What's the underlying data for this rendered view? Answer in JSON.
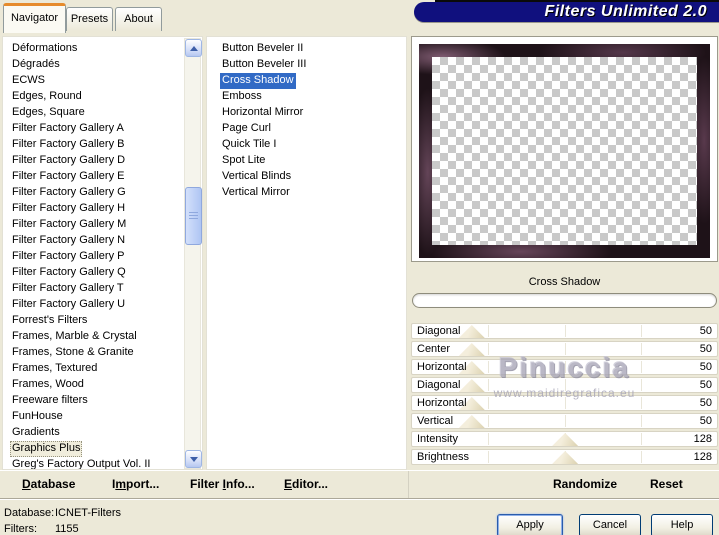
{
  "window": {
    "title": "Filters Unlimited 2.0"
  },
  "tabs": [
    {
      "label": "Navigator",
      "selected": true
    },
    {
      "label": "Presets",
      "selected": false
    },
    {
      "label": "About",
      "selected": false
    }
  ],
  "category_list": {
    "selected_index": 25,
    "items": [
      "Déformations",
      "Dégradés",
      "ECWS",
      "Edges, Round",
      "Edges, Square",
      "Filter Factory Gallery A",
      "Filter Factory Gallery B",
      "Filter Factory Gallery D",
      "Filter Factory Gallery E",
      "Filter Factory Gallery G",
      "Filter Factory Gallery H",
      "Filter Factory Gallery M",
      "Filter Factory Gallery N",
      "Filter Factory Gallery P",
      "Filter Factory Gallery Q",
      "Filter Factory Gallery T",
      "Filter Factory Gallery U",
      "Forrest's Filters",
      "Frames, Marble & Crystal",
      "Frames, Stone & Granite",
      "Frames, Textured",
      "Frames, Wood",
      "Freeware filters",
      "FunHouse",
      "Gradients",
      "Graphics Plus",
      "Greg's Factory Output Vol. II"
    ]
  },
  "filter_list": {
    "selected_index": 2,
    "items": [
      "Button Beveler II",
      "Button Beveler III",
      "Cross Shadow",
      "Emboss",
      "Horizontal Mirror",
      "Page Curl",
      "Quick Tile I",
      "Spot Lite",
      "Vertical Blinds",
      "Vertical Mirror"
    ]
  },
  "preview": {
    "filter_name": "Cross Shadow"
  },
  "sliders": [
    {
      "label": "Diagonal",
      "value": 50,
      "max": 255
    },
    {
      "label": "Center",
      "value": 50,
      "max": 255
    },
    {
      "label": "Horizontal",
      "value": 50,
      "max": 255
    },
    {
      "label": "Diagonal",
      "value": 50,
      "max": 255
    },
    {
      "label": "Horizontal",
      "value": 50,
      "max": 255
    },
    {
      "label": "Vertical",
      "value": 50,
      "max": 255
    },
    {
      "label": "Intensity",
      "value": 128,
      "max": 255
    },
    {
      "label": "Brightness",
      "value": 128,
      "max": 255
    }
  ],
  "toolbar": {
    "database": {
      "label": "Database",
      "accel": 0
    },
    "import": {
      "label": "Import...",
      "accel": 1
    },
    "filter_info": {
      "label": "Filter Info...",
      "accel": 7
    },
    "editor": {
      "label": "Editor...",
      "accel": 0
    },
    "randomize": {
      "label": "Randomize",
      "accel": -1
    },
    "reset": {
      "label": "Reset",
      "accel": -1
    }
  },
  "status": {
    "database_label": "Database:",
    "database_value": "ICNET-Filters",
    "filters_label": "Filters:",
    "filters_value": "1155"
  },
  "dialog_buttons": {
    "apply": "Apply",
    "cancel": "Cancel",
    "help": "Help"
  },
  "watermark": {
    "name": "Pinuccia",
    "url": "www.maidiregrafica.eu"
  },
  "colors": {
    "selection_blue": "#316AC5",
    "banner_navy": "#10107E",
    "tab_accent_orange": "#E68B2C",
    "frame_purple": "#1E1218",
    "xp_beige": "#ECE9D8"
  }
}
